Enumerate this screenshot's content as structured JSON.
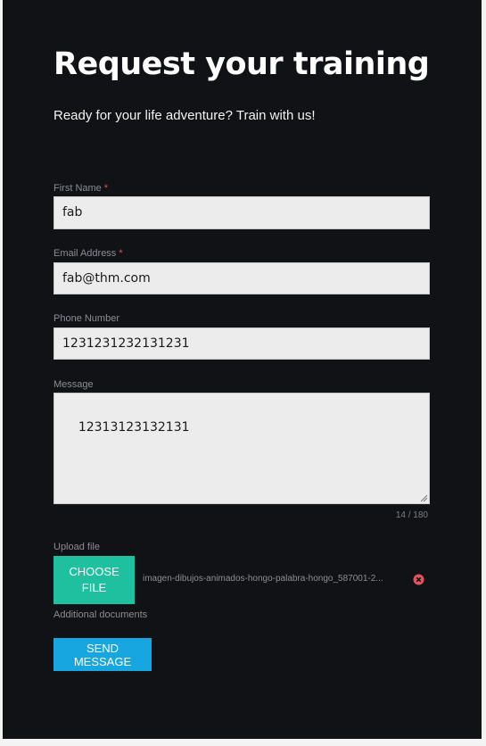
{
  "header": {
    "title": "Request your training",
    "subtitle": "Ready for your life adventure? Train with us!"
  },
  "form": {
    "required_marker": "*",
    "first_name": {
      "label": "First Name",
      "value": "fab",
      "required": true
    },
    "email": {
      "label": "Email Address",
      "value": "fab@thm.com",
      "required": true
    },
    "phone": {
      "label": "Phone Number",
      "value": "1231231232131231",
      "required": false
    },
    "message": {
      "label": "Message",
      "value": "12313123132131",
      "counter": "14 / 180"
    },
    "upload": {
      "label": "Upload file",
      "button_label": "Choose file",
      "file_name": "imagen-dibujos-animados-hongo-palabra-hongo_587001-2...",
      "helper": "Additional documents",
      "remove_icon": "close-circle-icon"
    },
    "submit_label": "Send message"
  },
  "colors": {
    "background": "#111216",
    "accent_teal": "#1ec0a0",
    "accent_blue": "#17a6e0",
    "required_red": "#e0555a"
  }
}
